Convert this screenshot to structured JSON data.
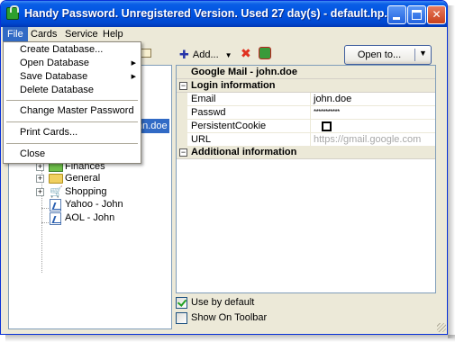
{
  "window": {
    "title": "Handy Password. Unregistered Version. Used 27 day(s) - default.hp..."
  },
  "menubar": {
    "items": [
      "File",
      "Cards",
      "Service",
      "Help"
    ]
  },
  "file_menu": {
    "create_database": "Create Database...",
    "open_database": "Open Database",
    "save_database": "Save Database",
    "delete_database": "Delete Database",
    "change_master_password": "Change Master Password",
    "print_cards": "Print Cards...",
    "close": "Close"
  },
  "toolbar": {
    "add_label": "Add...",
    "open_label": "Open to..."
  },
  "tree": {
    "selected_partial": "hn.doe",
    "items": [
      {
        "label": "Finances",
        "icon": "money-icon"
      },
      {
        "label": "General",
        "icon": "folder-icon"
      },
      {
        "label": "Shopping",
        "icon": "cart-icon"
      },
      {
        "label": "Yahoo - John",
        "icon": "card-icon"
      },
      {
        "label": "AOL - John",
        "icon": "card-icon"
      }
    ]
  },
  "card": {
    "title": "Google Mail - john.doe",
    "sections": {
      "login": "Login information",
      "additional": "Additional information"
    },
    "fields": [
      {
        "name": "Email",
        "value": "john.doe"
      },
      {
        "name": "Passwd",
        "value": "***********"
      },
      {
        "name": "PersistentCookie",
        "value": ""
      },
      {
        "name": "URL",
        "value": "https://gmail.google.com"
      }
    ]
  },
  "options": {
    "use_by_default": "Use by default",
    "use_by_default_checked": true,
    "show_on_toolbar": "Show On Toolbar",
    "show_on_toolbar_checked": false
  },
  "colors": {
    "titlebar": "#0053e1",
    "selection": "#316ac5",
    "window_bg": "#ece9d8"
  }
}
